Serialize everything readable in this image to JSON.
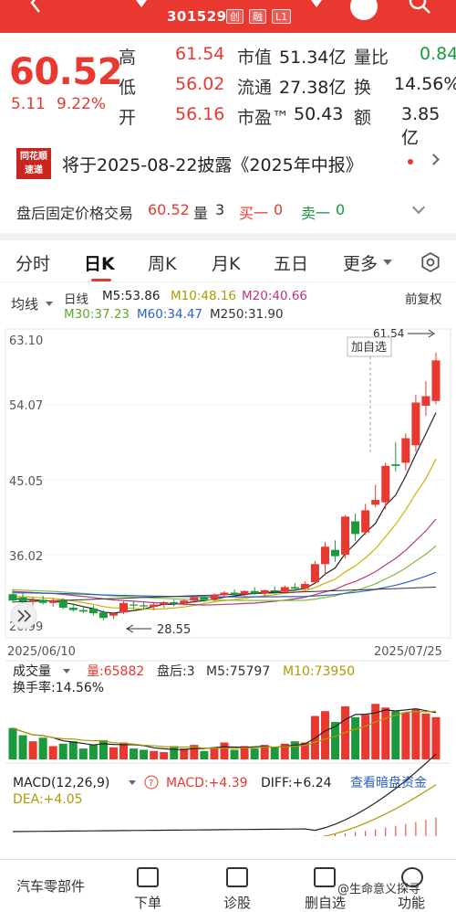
{
  "header": {
    "stock_code": "301529",
    "tags": [
      "创",
      "融",
      "L1"
    ]
  },
  "quote": {
    "price": "60.52",
    "change": "5.11",
    "change_pct": "9.22%",
    "rows": [
      {
        "l1": "高",
        "v1": "61.54",
        "l2": "市值",
        "v2": "51.34亿",
        "l3": "量比",
        "v3": "0.84"
      },
      {
        "l1": "低",
        "v1": "56.02",
        "l2": "流通",
        "v2": "27.38亿",
        "l3": "换",
        "v3": "14.56%"
      },
      {
        "l1": "开",
        "v1": "56.16",
        "l2": "市盈™",
        "v2": "50.43",
        "l3": "额",
        "v3": "3.85亿"
      }
    ]
  },
  "news": {
    "logo_line1": "同花顺",
    "logo_line2": "速递",
    "text": "将于2025-08-22披露《2025年中报》"
  },
  "after_hours": {
    "label": "盘后固定价格交易",
    "price": "60.52",
    "vol_label": "量",
    "vol": "3",
    "buy_label": "买一",
    "buy": "0",
    "sell_label": "卖一",
    "sell": "0"
  },
  "tabs": [
    "分时",
    "日K",
    "周K",
    "月K",
    "五日",
    "更多"
  ],
  "ma_legend": {
    "line_label": "均线",
    "line_type": "日线",
    "ma5": "M5:53.86",
    "ma10": "M10:48.16",
    "ma20": "M20:40.66",
    "ma30": "M30:37.23",
    "ma60": "M60:34.47",
    "ma250": "M250:31.90",
    "adjust": "前复权"
  },
  "kline": {
    "y_labels": [
      "63.10",
      "54.07",
      "45.05",
      "36.02",
      "26.99"
    ],
    "high_marker": "61.54",
    "low_marker": "28.55",
    "add_watch": "加自选",
    "date_start": "2025/06/10",
    "date_end": "2025/07/25"
  },
  "volume": {
    "title": "成交量",
    "vol": "量:65882",
    "after": "盘后:3",
    "m5": "M5:75797",
    "m10": "M10:73950",
    "turnover": "换手率:14.56%"
  },
  "macd": {
    "title": "MACD(12,26,9)",
    "macd": "MACD:+4.39",
    "diff": "DIFF:+6.24",
    "dea": "DEA:+4.05",
    "link": "查看暗盘资金"
  },
  "bottom": {
    "left": "汽车零部件",
    "items": [
      "下单",
      "诊股",
      "删自选",
      "功能"
    ]
  },
  "watermark": "@生命意义探寻",
  "colors": {
    "up": "#e8382f",
    "down": "#1a9a3c",
    "ma5": "#222222",
    "ma10": "#c9b400",
    "ma20": "#c0357f",
    "ma30": "#7cbf3a",
    "ma60": "#2a62c9",
    "ma250": "#333333"
  },
  "chart_data": {
    "type": "candlestick",
    "y_range": [
      26.99,
      63.1
    ],
    "candles": [
      {
        "o": 31.0,
        "h": 31.6,
        "l": 29.9,
        "c": 30.2
      },
      {
        "o": 30.6,
        "h": 31.2,
        "l": 29.8,
        "c": 30.1
      },
      {
        "o": 30.2,
        "h": 30.6,
        "l": 29.6,
        "c": 30.3
      },
      {
        "o": 30.3,
        "h": 30.8,
        "l": 29.7,
        "c": 29.9
      },
      {
        "o": 29.9,
        "h": 30.5,
        "l": 29.4,
        "c": 30.2
      },
      {
        "o": 30.2,
        "h": 30.5,
        "l": 29.1,
        "c": 29.3
      },
      {
        "o": 29.3,
        "h": 29.8,
        "l": 28.8,
        "c": 29.0
      },
      {
        "o": 29.0,
        "h": 29.4,
        "l": 28.6,
        "c": 28.8
      },
      {
        "o": 29.2,
        "h": 29.6,
        "l": 28.3,
        "c": 28.6
      },
      {
        "o": 28.7,
        "h": 29.0,
        "l": 27.7,
        "c": 28.0
      },
      {
        "o": 28.3,
        "h": 28.7,
        "l": 27.9,
        "c": 28.6
      },
      {
        "o": 28.7,
        "h": 30.1,
        "l": 28.5,
        "c": 29.9
      },
      {
        "o": 29.7,
        "h": 30.1,
        "l": 29.2,
        "c": 29.6
      },
      {
        "o": 29.6,
        "h": 30.0,
        "l": 29.1,
        "c": 29.5
      },
      {
        "o": 29.4,
        "h": 29.9,
        "l": 29.0,
        "c": 29.7
      },
      {
        "o": 29.7,
        "h": 30.1,
        "l": 29.3,
        "c": 30.0
      },
      {
        "o": 30.0,
        "h": 30.3,
        "l": 29.5,
        "c": 29.8
      },
      {
        "o": 29.8,
        "h": 30.4,
        "l": 29.6,
        "c": 30.2
      },
      {
        "o": 30.2,
        "h": 30.9,
        "l": 29.9,
        "c": 30.6
      },
      {
        "o": 30.6,
        "h": 30.9,
        "l": 30.0,
        "c": 30.3
      },
      {
        "o": 30.4,
        "h": 31.1,
        "l": 30.1,
        "c": 30.9
      },
      {
        "o": 30.9,
        "h": 31.4,
        "l": 30.5,
        "c": 31.2
      },
      {
        "o": 31.2,
        "h": 31.6,
        "l": 30.8,
        "c": 31.0
      },
      {
        "o": 31.0,
        "h": 31.5,
        "l": 30.7,
        "c": 31.4
      },
      {
        "o": 31.4,
        "h": 31.9,
        "l": 30.9,
        "c": 31.1
      },
      {
        "o": 31.1,
        "h": 31.6,
        "l": 30.8,
        "c": 31.5
      },
      {
        "o": 31.5,
        "h": 32.0,
        "l": 31.0,
        "c": 31.3
      },
      {
        "o": 31.3,
        "h": 32.1,
        "l": 31.1,
        "c": 31.9
      },
      {
        "o": 31.9,
        "h": 32.4,
        "l": 31.4,
        "c": 31.7
      },
      {
        "o": 31.7,
        "h": 32.6,
        "l": 31.5,
        "c": 32.3
      },
      {
        "o": 32.5,
        "h": 35.2,
        "l": 32.3,
        "c": 34.8
      },
      {
        "o": 34.8,
        "h": 37.6,
        "l": 33.4,
        "c": 37.0
      },
      {
        "o": 36.6,
        "h": 37.8,
        "l": 35.1,
        "c": 35.8
      },
      {
        "o": 36.0,
        "h": 41.0,
        "l": 35.5,
        "c": 40.8
      },
      {
        "o": 40.2,
        "h": 41.2,
        "l": 37.7,
        "c": 38.6
      },
      {
        "o": 38.8,
        "h": 42.4,
        "l": 38.5,
        "c": 41.6
      },
      {
        "o": 42.3,
        "h": 44.8,
        "l": 42.0,
        "c": 42.9
      },
      {
        "o": 42.6,
        "h": 47.6,
        "l": 41.7,
        "c": 47.2
      },
      {
        "o": 47.4,
        "h": 50.2,
        "l": 46.5,
        "c": 47.2
      },
      {
        "o": 47.6,
        "h": 51.3,
        "l": 46.6,
        "c": 50.7
      },
      {
        "o": 49.8,
        "h": 56.2,
        "l": 49.0,
        "c": 55.2
      },
      {
        "o": 54.8,
        "h": 57.9,
        "l": 53.5,
        "c": 56.0
      },
      {
        "o": 55.4,
        "h": 61.54,
        "l": 55.0,
        "c": 60.52
      }
    ]
  }
}
